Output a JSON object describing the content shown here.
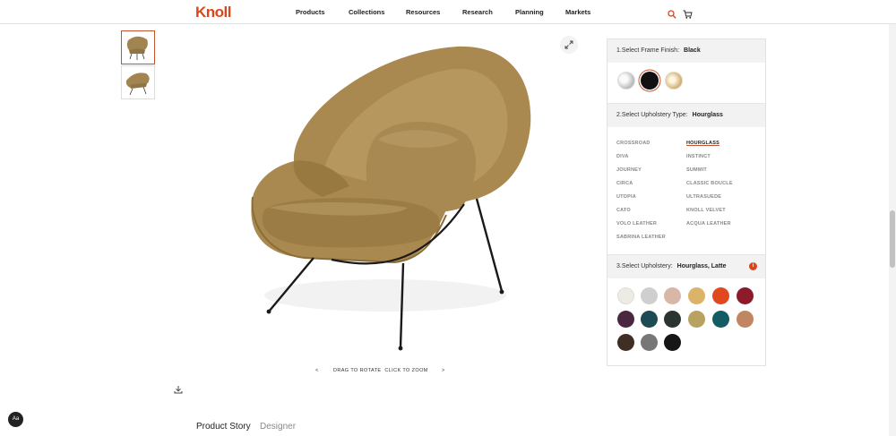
{
  "header": {
    "logo": "Knoll",
    "nav": [
      "Products",
      "Collections",
      "Resources",
      "Research",
      "Planning",
      "Markets"
    ]
  },
  "viewer": {
    "prev": "<",
    "hint": "DRAG TO ROTATE  CLICK TO ZOOM",
    "next": ">"
  },
  "tabs": {
    "story": "Product Story",
    "designer": "Designer"
  },
  "aa": "Aa",
  "config": {
    "frame": {
      "label": "1.Select Frame Finish:",
      "value": "Black",
      "finishes": [
        "chrome",
        "black",
        "gold"
      ],
      "selected": "black"
    },
    "type": {
      "label": "2.Select Upholstery Type:",
      "value": "Hourglass",
      "options": [
        "CROSSROAD",
        "HOURGLASS",
        "DIVA",
        "INSTINCT",
        "JOURNEY",
        "SUMMIT",
        "CIRCA",
        "CLASSIC BOUCLE",
        "UTOPIA",
        "ULTRASUEDE",
        "CATO",
        "KNOLL VELVET",
        "VOLO LEATHER",
        "ACQUA LEATHER",
        "SABRINA LEATHER"
      ],
      "selected": "HOURGLASS"
    },
    "upholstery": {
      "label": "3.Select Upholstery:",
      "value": "Hourglass, Latte",
      "swatches": [
        "#eeeae4",
        "#cfcfcf",
        "#d9b7a6",
        "#dcb469",
        "#e0491f",
        "#8d1b2b",
        "#4a2740",
        "#1e4a55",
        "#2c3431",
        "#b7a262",
        "#145c65",
        "#c08661",
        "#3f2e23",
        "#777777",
        "#161616"
      ]
    }
  }
}
